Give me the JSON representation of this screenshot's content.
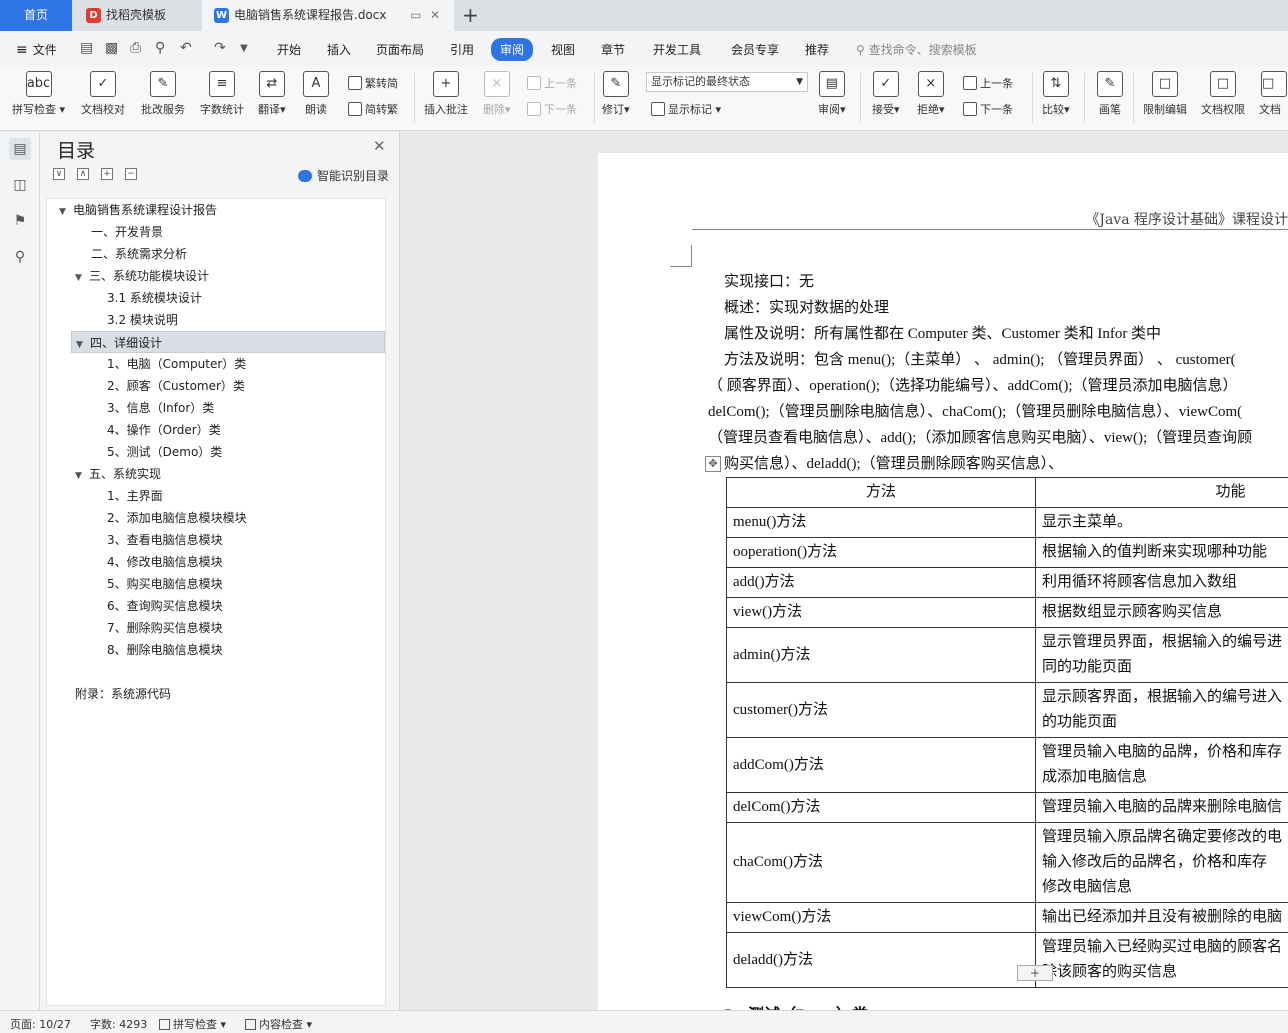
{
  "tabs": {
    "home": "首页",
    "daoke": "找稻壳模板",
    "doc": "电脑销售系统课程报告.docx",
    "icon_daoke": "daoke-icon",
    "icon_doc": "wps-writer-icon"
  },
  "menu": {
    "file": "文件",
    "items": [
      "开始",
      "插入",
      "页面布局",
      "引用",
      "审阅",
      "视图",
      "章节",
      "开发工具",
      "会员专享",
      "推荐"
    ],
    "active": "审阅",
    "search_placeholder": "查找命令、搜索模板"
  },
  "ribbon": {
    "spell_check": "拼写检查",
    "doc_proof": "文档校对",
    "batch_service": "批改服务",
    "word_count": "字数统计",
    "translate": "翻译",
    "read_aloud": "朗读",
    "trad_to_simp": "繁转简",
    "simp_to_trad": "简转繁",
    "insert_comment": "插入批注",
    "delete": "删除",
    "prev_comment": "上一条",
    "next_comment": "下一条",
    "track_changes": "修订",
    "markup_state": "显示标记的最终状态",
    "show_markup": "显示标记",
    "review": "审阅",
    "accept": "接受",
    "reject": "拒绝",
    "prev_change": "上一条",
    "next_change": "下一条",
    "compare": "比较",
    "pen": "画笔",
    "restrict_edit": "限制编辑",
    "doc_permission": "文档权限",
    "doc_cut": "文档"
  },
  "toc": {
    "title": "目录",
    "smart_label": "智能识别目录",
    "items": [
      "电脑销售系统课程设计报告",
      "一、开发背景",
      "二、系统需求分析",
      "三、系统功能模块设计",
      "3.1  系统模块设计",
      "3.2  模块说明",
      "四、详细设计",
      "1、电脑（Computer）类",
      "2、顾客（Customer）类",
      "3、信息（Infor）类",
      "4、操作（Order）类",
      "5、测试（Demo）类",
      "五、系统实现",
      "1、主界面",
      "2、添加电脑信息模块模块",
      "3、查看电脑信息模块",
      "4、修改电脑信息模块",
      "5、购买电脑信息模块",
      "6、查询购买信息模块",
      "7、删除购买信息模块",
      "8、删除电脑信息模块",
      "附录：系统源代码"
    ]
  },
  "document": {
    "header": "《Java 程序设计基础》课程设计",
    "lines": [
      "实现接口：无",
      "概述：实现对数据的处理",
      "属性及说明：所有属性都在 Computer 类、Customer 类和 Infor 类中",
      "方法及说明：包含 menu();（主菜单）  、  admin();  （管理员界面）  、  customer(",
      "（  顾客界面）、operation();（选择功能编号）、addCom();（管理员添加电脑信息）",
      "delCom();（管理员删除电脑信息）、chaCom();（管理员删除电脑信息）、viewCom(",
      "（管理员查看电脑信息）、add();（添加顾客信息购买电脑）、view();（管理员查询顾",
      "购买信息）、deladd();（管理员删除顾客购买信息）、"
    ],
    "table_headers": [
      "方法",
      "功能"
    ],
    "table_rows": [
      [
        "menu()方法",
        "显示主菜单。"
      ],
      [
        "ooperation()方法",
        "根据输入的值判断来实现哪种功能"
      ],
      [
        "add()方法",
        "利用循环将顾客信息加入数组"
      ],
      [
        "view()方法",
        "根据数组显示顾客购买信息"
      ],
      [
        "admin()方法",
        "显示管理员界面，根据输入的编号进",
        "同的功能页面"
      ],
      [
        "customer()方法",
        "显示顾客界面，根据输入的编号进入",
        "的功能页面"
      ],
      [
        "addCom()方法",
        "管理员输入电脑的品牌，价格和库存",
        "成添加电脑信息"
      ],
      [
        "delCom()方法",
        "管理员输入电脑的品牌来删除电脑信"
      ],
      [
        "chaCom()方法",
        "管理员输入原品牌名确定要修改的电",
        "输入修改后的品牌名，价格和库存",
        "修改电脑信息"
      ],
      [
        "viewCom()方法",
        "输出已经添加并且没有被删除的电脑"
      ],
      [
        "deladd()方法",
        "管理员输入已经购买过电脑的顾客名",
        "除该顾客的购买信息"
      ]
    ],
    "next_heading": "5、测试（Demo）类"
  },
  "status": {
    "page": "页面: 10/27",
    "words": "字数: 4293",
    "spell": "拼写检查",
    "content": "内容检查"
  },
  "colors": {
    "accent": "#2f74e6",
    "daoke": "#e23b33"
  }
}
